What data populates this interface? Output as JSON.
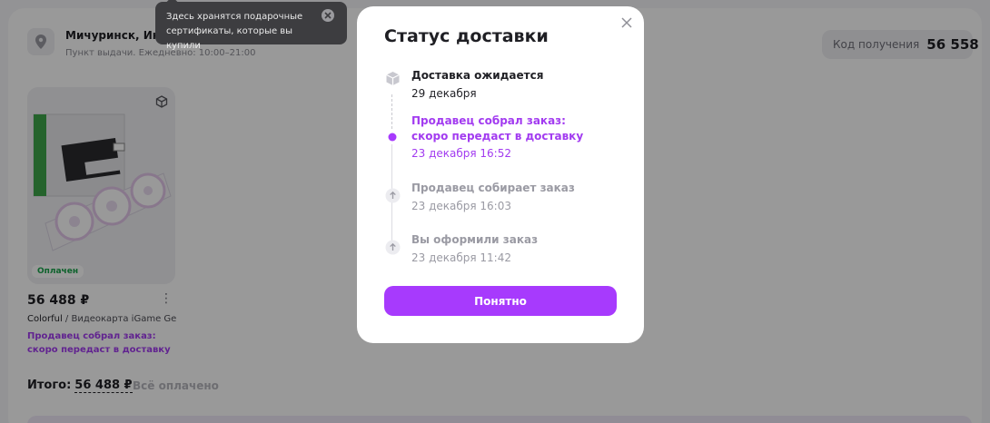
{
  "pickup": {
    "city": "Мичуринск, Интерн",
    "hours": "Пункт выдачи. Ежедневно: 10:00–21:00"
  },
  "code": {
    "label": "Код получения",
    "value": "56 558"
  },
  "product": {
    "paid_badge": "Оплачен",
    "price": "56 488 ₽",
    "brand": "Colorful",
    "name_rest": " / Видеокарта iGame Ge…",
    "status": "Продавец собрал заказ: скоро передаст в доставку"
  },
  "total": {
    "label": "Итого:",
    "amount": "56 488 ₽",
    "paid_status": "Всё оплачено"
  },
  "tooltip": {
    "text": "Здесь хранятся подарочные сертификаты, которые вы купили"
  },
  "modal": {
    "title": "Статус доставки",
    "steps": [
      {
        "title": "Доставка ожидается",
        "date": "29 декабря",
        "state": "pending"
      },
      {
        "title": "Продавец собрал заказ: скоро передаст в доставку",
        "date": "23 декабря 16:52",
        "state": "current"
      },
      {
        "title": "Продавец собирает заказ",
        "date": "23 декабря 16:03",
        "state": "done"
      },
      {
        "title": "Вы оформили заказ",
        "date": "23 декабря 11:42",
        "state": "done"
      }
    ],
    "ok_label": "Понятно"
  },
  "colors": {
    "accent": "#a73afd",
    "current_text": "#a23bf0",
    "done_text": "#9a9aa3",
    "paid_green": "#17a34a"
  }
}
